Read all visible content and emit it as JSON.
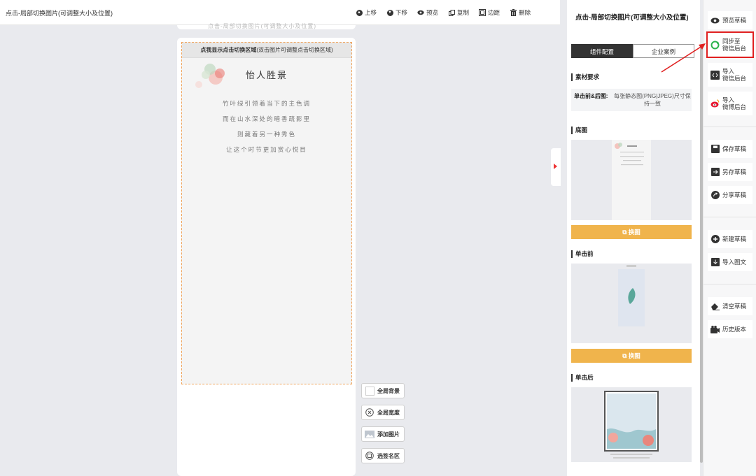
{
  "topbar": {
    "title": "点击-局部切换图片(可调整大小及位置)",
    "tools": [
      {
        "icon": "arrow-up-icon",
        "label": "上移"
      },
      {
        "icon": "arrow-down-icon",
        "label": "下移"
      },
      {
        "icon": "eye-icon",
        "label": "预览"
      },
      {
        "icon": "copy-icon",
        "label": "复制"
      },
      {
        "icon": "margin-icon",
        "label": "边距"
      },
      {
        "icon": "trash-icon",
        "label": "删除"
      }
    ]
  },
  "canvas": {
    "peek_text": "点击-局部切换图片(可调整大小及位置)",
    "zone_header_bold": "点我显示点击切换区域",
    "zone_header_note": "(双击图片可调整点击切换区域)",
    "poem_title": "怡人胜景",
    "poem_lines": [
      "竹叶绿引领着当下的主色调",
      "而在山水深处的暗香疏影里",
      "则藏着另一种秀色",
      "让这个时节更加赏心悦目"
    ]
  },
  "float_buttons": [
    {
      "icon": "square-icon",
      "label": "全局背景"
    },
    {
      "icon": "close-circle-icon",
      "label": "全局宽度"
    },
    {
      "icon": "image-icon",
      "label": "添加图片"
    },
    {
      "icon": "tag-icon",
      "label": "选签名区"
    }
  ],
  "panel": {
    "title": "点击-局部切换图片(可调整大小及位置)",
    "tab_active": "组件配置",
    "tab_inactive": "企业案例",
    "material_title": "素材要求",
    "req_key": "单击前&后图:",
    "req_value": "每张静态图(PNG|JPEG)尺寸保持一致",
    "base_title": "底图",
    "before_title": "单击前",
    "after_title": "单击后",
    "change_label": "换图",
    "change_label_2": "换图"
  },
  "actions": {
    "preview": "预览草稿",
    "sync_line1": "同步至",
    "sync_line2": "微信后台",
    "import_wx_line1": "导入",
    "import_wx_line2": "微信后台",
    "import_wb_line1": "导入",
    "import_wb_line2": "微博后台",
    "save": "保存草稿",
    "save_as": "另存草稿",
    "share": "分享草稿",
    "new": "新建草稿",
    "import_article": "导入图文",
    "clear": "清空草稿",
    "history": "历史版本"
  },
  "colors": {
    "accent_orange": "#f0b44c",
    "highlight_red": "#e02020",
    "sync_green": "#2bb24c",
    "weibo_red": "#e6162d"
  }
}
